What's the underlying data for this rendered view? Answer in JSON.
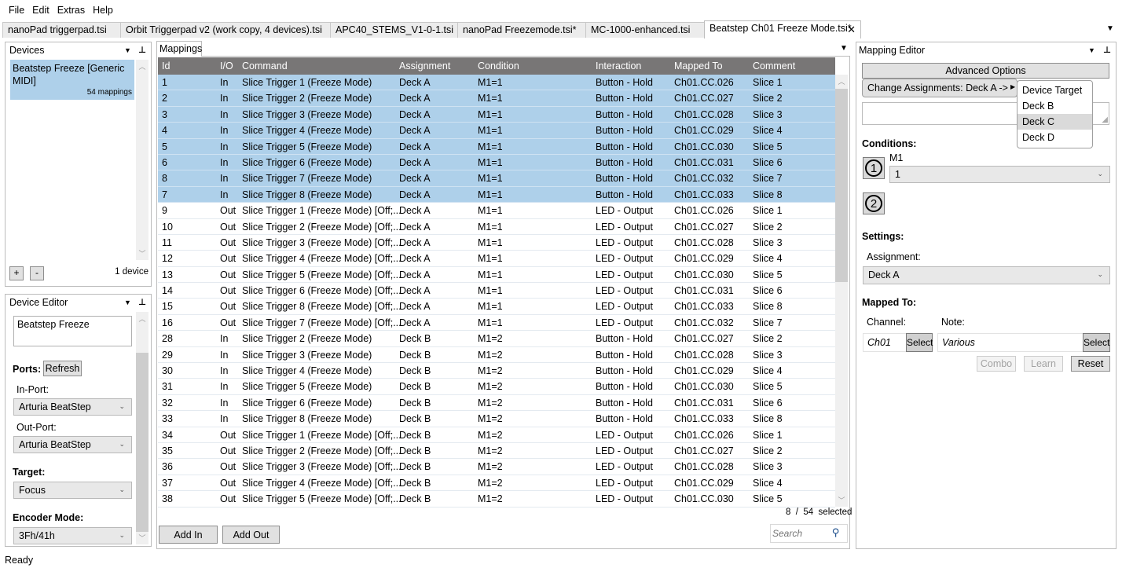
{
  "menu": [
    "File",
    "Edit",
    "Extras",
    "Help"
  ],
  "file_tabs": [
    {
      "label": "nanoPad triggerpad.tsi",
      "active": false
    },
    {
      "label": "Orbit Triggerpad v2 (work copy, 4 devices).tsi",
      "active": false
    },
    {
      "label": "APC40_STEMS_V1-0-1.tsi",
      "active": false
    },
    {
      "label": "nanoPad Freezemode.tsi*",
      "active": false
    },
    {
      "label": "MC-1000-enhanced.tsi",
      "active": false
    },
    {
      "label": "Beatstep Ch01 Freeze Mode.tsi*",
      "active": true,
      "close": "✕"
    }
  ],
  "devices": {
    "title": "Devices",
    "items": [
      {
        "name": "Beatstep Freeze [Generic MIDI]",
        "count": "54 mappings",
        "selected": true
      }
    ],
    "add": "+",
    "remove": "-",
    "count_label": "1 device"
  },
  "device_editor": {
    "title": "Device Editor",
    "name_value": "Beatstep Freeze",
    "ports_label": "Ports:",
    "refresh": "Refresh",
    "in_port_label": "In-Port:",
    "in_port": "Arturia BeatStep",
    "out_port_label": "Out-Port:",
    "out_port": "Arturia BeatStep",
    "target_label": "Target:",
    "target": "Focus",
    "encoder_label": "Encoder Mode:",
    "encoder": "3Fh/41h"
  },
  "mappings": {
    "tab": "Mappings",
    "columns": [
      "Id",
      "I/O",
      "Command",
      "Assignment",
      "Condition",
      "Interaction",
      "Mapped To",
      "Comment"
    ],
    "rows": [
      {
        "id": "1",
        "io": "In",
        "command": "Slice Trigger 1 (Freeze Mode)",
        "assignment": "Deck A",
        "condition": "M1=1",
        "interaction": "Button - Hold",
        "mapped": "Ch01.CC.026",
        "comment": "Slice 1",
        "sel": true
      },
      {
        "id": "2",
        "io": "In",
        "command": "Slice Trigger 2 (Freeze Mode)",
        "assignment": "Deck A",
        "condition": "M1=1",
        "interaction": "Button - Hold",
        "mapped": "Ch01.CC.027",
        "comment": "Slice 2",
        "sel": true
      },
      {
        "id": "3",
        "io": "In",
        "command": "Slice Trigger 3 (Freeze Mode)",
        "assignment": "Deck A",
        "condition": "M1=1",
        "interaction": "Button - Hold",
        "mapped": "Ch01.CC.028",
        "comment": "Slice 3",
        "sel": true
      },
      {
        "id": "4",
        "io": "In",
        "command": "Slice Trigger 4 (Freeze Mode)",
        "assignment": "Deck A",
        "condition": "M1=1",
        "interaction": "Button - Hold",
        "mapped": "Ch01.CC.029",
        "comment": "Slice 4",
        "sel": true
      },
      {
        "id": "5",
        "io": "In",
        "command": "Slice Trigger 5 (Freeze Mode)",
        "assignment": "Deck A",
        "condition": "M1=1",
        "interaction": "Button - Hold",
        "mapped": "Ch01.CC.030",
        "comment": "Slice 5",
        "sel": true
      },
      {
        "id": "6",
        "io": "In",
        "command": "Slice Trigger 6 (Freeze Mode)",
        "assignment": "Deck A",
        "condition": "M1=1",
        "interaction": "Button - Hold",
        "mapped": "Ch01.CC.031",
        "comment": "Slice 6",
        "sel": true
      },
      {
        "id": "8",
        "io": "In",
        "command": "Slice Trigger 7 (Freeze Mode)",
        "assignment": "Deck A",
        "condition": "M1=1",
        "interaction": "Button - Hold",
        "mapped": "Ch01.CC.032",
        "comment": "Slice 7",
        "sel": true
      },
      {
        "id": "7",
        "io": "In",
        "command": "Slice Trigger 8 (Freeze Mode)",
        "assignment": "Deck A",
        "condition": "M1=1",
        "interaction": "Button - Hold",
        "mapped": "Ch01.CC.033",
        "comment": "Slice 8",
        "sel": true
      },
      {
        "id": "9",
        "io": "Out",
        "command": "Slice Trigger 1 (Freeze Mode) [Off;...",
        "assignment": "Deck A",
        "condition": "M1=1",
        "interaction": "LED - Output",
        "mapped": "Ch01.CC.026",
        "comment": "Slice 1",
        "sel": false
      },
      {
        "id": "10",
        "io": "Out",
        "command": "Slice Trigger 2 (Freeze Mode) [Off;...",
        "assignment": "Deck A",
        "condition": "M1=1",
        "interaction": "LED - Output",
        "mapped": "Ch01.CC.027",
        "comment": "Slice 2",
        "sel": false
      },
      {
        "id": "11",
        "io": "Out",
        "command": "Slice Trigger 3 (Freeze Mode) [Off;...",
        "assignment": "Deck A",
        "condition": "M1=1",
        "interaction": "LED - Output",
        "mapped": "Ch01.CC.028",
        "comment": "Slice 3",
        "sel": false
      },
      {
        "id": "12",
        "io": "Out",
        "command": "Slice Trigger 4 (Freeze Mode) [Off;...",
        "assignment": "Deck A",
        "condition": "M1=1",
        "interaction": "LED - Output",
        "mapped": "Ch01.CC.029",
        "comment": "Slice 4",
        "sel": false
      },
      {
        "id": "13",
        "io": "Out",
        "command": "Slice Trigger 5 (Freeze Mode) [Off;...",
        "assignment": "Deck A",
        "condition": "M1=1",
        "interaction": "LED - Output",
        "mapped": "Ch01.CC.030",
        "comment": "Slice 5",
        "sel": false
      },
      {
        "id": "14",
        "io": "Out",
        "command": "Slice Trigger 6 (Freeze Mode) [Off;...",
        "assignment": "Deck A",
        "condition": "M1=1",
        "interaction": "LED - Output",
        "mapped": "Ch01.CC.031",
        "comment": "Slice 6",
        "sel": false
      },
      {
        "id": "15",
        "io": "Out",
        "command": "Slice Trigger 8 (Freeze Mode) [Off;...",
        "assignment": "Deck A",
        "condition": "M1=1",
        "interaction": "LED - Output",
        "mapped": "Ch01.CC.033",
        "comment": "Slice 8",
        "sel": false
      },
      {
        "id": "16",
        "io": "Out",
        "command": "Slice Trigger 7 (Freeze Mode) [Off;...",
        "assignment": "Deck A",
        "condition": "M1=1",
        "interaction": "LED - Output",
        "mapped": "Ch01.CC.032",
        "comment": "Slice 7",
        "sel": false
      },
      {
        "id": "28",
        "io": "In",
        "command": "Slice Trigger 2 (Freeze Mode)",
        "assignment": "Deck B",
        "condition": "M1=2",
        "interaction": "Button - Hold",
        "mapped": "Ch01.CC.027",
        "comment": "Slice 2",
        "sel": false
      },
      {
        "id": "29",
        "io": "In",
        "command": "Slice Trigger 3 (Freeze Mode)",
        "assignment": "Deck B",
        "condition": "M1=2",
        "interaction": "Button - Hold",
        "mapped": "Ch01.CC.028",
        "comment": "Slice 3",
        "sel": false
      },
      {
        "id": "30",
        "io": "In",
        "command": "Slice Trigger 4 (Freeze Mode)",
        "assignment": "Deck B",
        "condition": "M1=2",
        "interaction": "Button - Hold",
        "mapped": "Ch01.CC.029",
        "comment": "Slice 4",
        "sel": false
      },
      {
        "id": "31",
        "io": "In",
        "command": "Slice Trigger 5 (Freeze Mode)",
        "assignment": "Deck B",
        "condition": "M1=2",
        "interaction": "Button - Hold",
        "mapped": "Ch01.CC.030",
        "comment": "Slice 5",
        "sel": false
      },
      {
        "id": "32",
        "io": "In",
        "command": "Slice Trigger 6 (Freeze Mode)",
        "assignment": "Deck B",
        "condition": "M1=2",
        "interaction": "Button - Hold",
        "mapped": "Ch01.CC.031",
        "comment": "Slice 6",
        "sel": false
      },
      {
        "id": "33",
        "io": "In",
        "command": "Slice Trigger 8 (Freeze Mode)",
        "assignment": "Deck B",
        "condition": "M1=2",
        "interaction": "Button - Hold",
        "mapped": "Ch01.CC.033",
        "comment": "Slice 8",
        "sel": false
      },
      {
        "id": "34",
        "io": "Out",
        "command": "Slice Trigger 1 (Freeze Mode) [Off;...",
        "assignment": "Deck B",
        "condition": "M1=2",
        "interaction": "LED - Output",
        "mapped": "Ch01.CC.026",
        "comment": "Slice 1",
        "sel": false
      },
      {
        "id": "35",
        "io": "Out",
        "command": "Slice Trigger 2 (Freeze Mode) [Off;...",
        "assignment": "Deck B",
        "condition": "M1=2",
        "interaction": "LED - Output",
        "mapped": "Ch01.CC.027",
        "comment": "Slice 2",
        "sel": false
      },
      {
        "id": "36",
        "io": "Out",
        "command": "Slice Trigger 3 (Freeze Mode) [Off;...",
        "assignment": "Deck B",
        "condition": "M1=2",
        "interaction": "LED - Output",
        "mapped": "Ch01.CC.028",
        "comment": "Slice 3",
        "sel": false
      },
      {
        "id": "37",
        "io": "Out",
        "command": "Slice Trigger 4 (Freeze Mode) [Off;...",
        "assignment": "Deck B",
        "condition": "M1=2",
        "interaction": "LED - Output",
        "mapped": "Ch01.CC.029",
        "comment": "Slice 4",
        "sel": false
      },
      {
        "id": "38",
        "io": "Out",
        "command": "Slice Trigger 5 (Freeze Mode) [Off;...",
        "assignment": "Deck B",
        "condition": "M1=2",
        "interaction": "LED - Output",
        "mapped": "Ch01.CC.030",
        "comment": "Slice 5",
        "sel": false
      }
    ],
    "selection_status": "8  /  54  selected",
    "add_in": "Add In",
    "add_out": "Add Out",
    "search_placeholder": "Search"
  },
  "mapping_editor": {
    "title": "Mapping Editor",
    "advanced": "Advanced Options",
    "change_assign": "Change Assignments: Deck A ->",
    "submenu": [
      {
        "label": "Device Target",
        "hl": false
      },
      {
        "label": "Deck B",
        "hl": false
      },
      {
        "label": "Deck C",
        "hl": true
      },
      {
        "label": "Deck D",
        "hl": false
      }
    ],
    "conditions_label": "Conditions:",
    "cond1": "1",
    "cond2": "2",
    "m1_label": "M1",
    "m1_value": "1",
    "settings_label": "Settings:",
    "assignment_label": "Assignment:",
    "assignment": "Deck A",
    "mapped_to_label": "Mapped To:",
    "channel_label": "Channel:",
    "channel": "Ch01",
    "note_label": "Note:",
    "note": "Various",
    "select": "Select",
    "combo": "Combo",
    "learn": "Learn",
    "reset": "Reset"
  },
  "status": "Ready",
  "colors": {
    "selection": "#aed0ea",
    "header": "#787676"
  }
}
